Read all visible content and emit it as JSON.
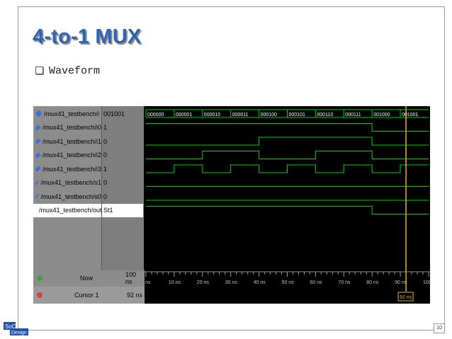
{
  "slide": {
    "title": "4-to-1 MUX",
    "bullet": "Waveform",
    "page_number": "10"
  },
  "waveform": {
    "signals": [
      {
        "name": "/mux41_testbench/i",
        "value": "001001",
        "kind": "bus",
        "selected": false
      },
      {
        "name": "/mux41_testbench/i0",
        "value": "1",
        "kind": "bit",
        "selected": false,
        "levels": [
          1,
          1,
          1,
          1,
          1,
          1,
          1,
          1,
          0,
          0
        ]
      },
      {
        "name": "/mux41_testbench/i1",
        "value": "0",
        "kind": "bit",
        "selected": false,
        "levels": [
          0,
          0,
          0,
          0,
          1,
          1,
          1,
          1,
          0,
          0
        ]
      },
      {
        "name": "/mux41_testbench/i2",
        "value": "0",
        "kind": "bit",
        "selected": false,
        "levels": [
          0,
          0,
          1,
          1,
          0,
          0,
          1,
          1,
          0,
          0
        ]
      },
      {
        "name": "/mux41_testbench/i3",
        "value": "1",
        "kind": "bit",
        "selected": false,
        "levels": [
          0,
          1,
          0,
          1,
          0,
          1,
          0,
          1,
          0,
          1
        ]
      },
      {
        "name": "/mux41_testbench/s1",
        "value": "0",
        "kind": "bit",
        "selected": false,
        "levels": [
          0,
          0,
          0,
          0,
          0,
          0,
          0,
          0,
          0,
          0
        ]
      },
      {
        "name": "/mux41_testbench/s0",
        "value": "0",
        "kind": "bit",
        "selected": false,
        "levels": [
          0,
          0,
          0,
          0,
          0,
          0,
          0,
          0,
          0,
          0
        ]
      },
      {
        "name": "/mux41_testbench/out",
        "value": "St1",
        "kind": "bit",
        "selected": true,
        "levels": [
          1,
          1,
          1,
          1,
          1,
          1,
          1,
          1,
          0,
          0
        ]
      }
    ],
    "bus_values": [
      "000000",
      "000001",
      "000010",
      "000011",
      "000100",
      "000101",
      "000110",
      "000111",
      "001000",
      "001001"
    ],
    "segment_ns": 10,
    "time_range_ns": [
      0,
      100
    ],
    "ticks": [
      "ns",
      "10 ns",
      "20 ns",
      "30 ns",
      "40 ns",
      "50 ns",
      "60 ns",
      "70 ns",
      "80 ns",
      "90 ns",
      "100"
    ],
    "now_label": "Now",
    "now_value": "100 ns",
    "cursor_label": "Cursor 1",
    "cursor_value": "92 ns",
    "cursor_ns": 92,
    "cursor_flag": "92 ns",
    "colors": {
      "wave": "#00d000",
      "bus_text": "#ffffff",
      "cursor": "#e0b040",
      "grid": "#3a3a3a"
    }
  },
  "logo": {
    "line1": "SoC",
    "line2": "Design"
  }
}
